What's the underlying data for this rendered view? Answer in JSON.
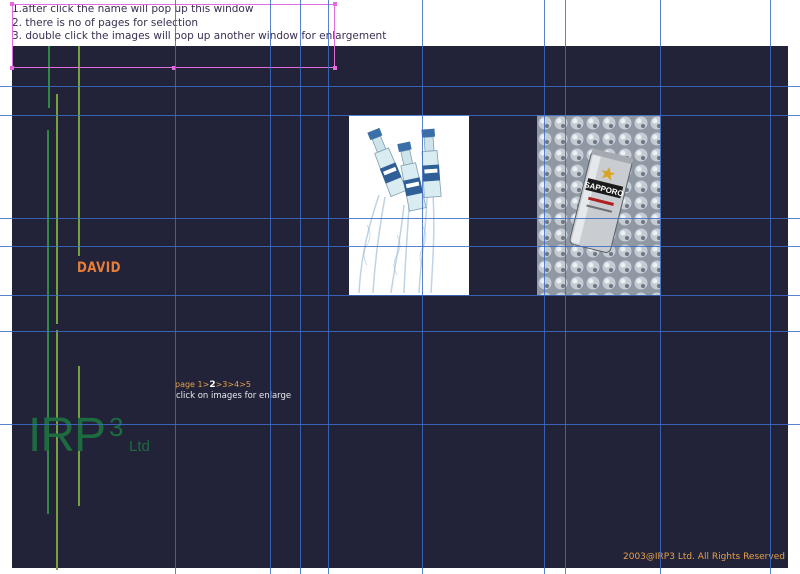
{
  "notes": [
    "1.after click the name will pop up this window",
    "2. there is no of pages for selection",
    "3. double click the images will pop up another window for enlargement"
  ],
  "artist_name": "DAVID",
  "pagination": {
    "prefix": "page",
    "pages": [
      "1",
      "2",
      "3",
      "4",
      "5"
    ],
    "current": "2",
    "separator": ">"
  },
  "hint": "click on images for enlarge",
  "logo": {
    "main": "IRP",
    "sup": "3",
    "suffix": "Ltd"
  },
  "footer": "2003@IRP3 Ltd. All Rights Reserved",
  "images": [
    {
      "name": "water-bottles-photo",
      "subject": "three bottles with splashing water"
    },
    {
      "name": "sapporo-can-photo",
      "subject": "SAPPORO beer can on ice"
    }
  ],
  "colors": {
    "panel": "#222339",
    "accent_orange": "#e67e3a",
    "logo_green": "#1d6b3f",
    "guide_blue": "#3c6cc7",
    "selection_magenta": "#e36be0"
  }
}
